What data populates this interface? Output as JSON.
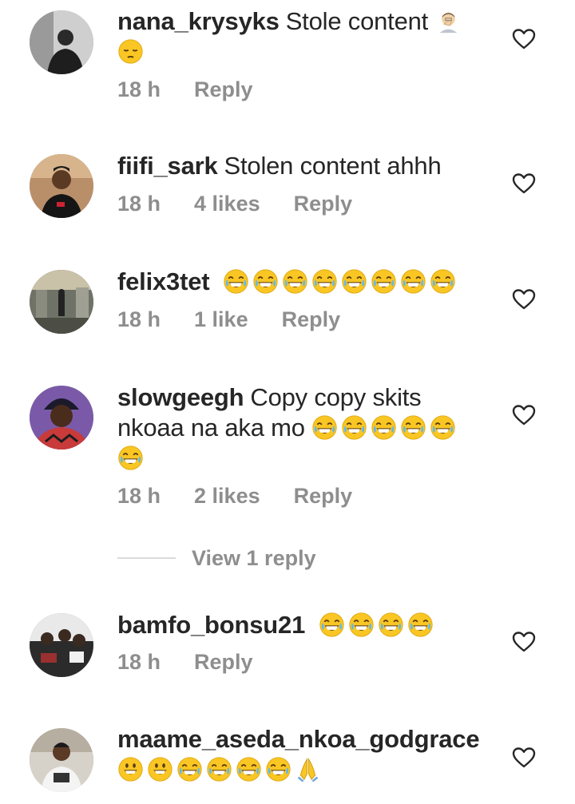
{
  "comments": [
    {
      "username": "nana_krysyks",
      "text": "Stole content",
      "time": "18 h",
      "likes": "",
      "reply": "Reply"
    },
    {
      "username": "fiifi_sark",
      "text": "Stolen content ahhh",
      "time": "18 h",
      "likes": "4 likes",
      "reply": "Reply"
    },
    {
      "username": "felix3tet",
      "text": "",
      "time": "18 h",
      "likes": "1 like",
      "reply": "Reply"
    },
    {
      "username": "slowgeegh",
      "text": "Copy copy skits nkoaa na aka mo",
      "time": "18 h",
      "likes": "2 likes",
      "reply": "Reply"
    },
    {
      "username": "bamfo_bonsu21",
      "text": "",
      "time": "18 h",
      "likes": "",
      "reply": "Reply"
    },
    {
      "username": "maame_aseda_nkoa_godgrace",
      "text": "",
      "time": "",
      "likes": "",
      "reply": ""
    }
  ],
  "view_replies_label": "View 1 reply",
  "icons": {
    "like": "heart-outline-icon",
    "emoji_laugh": "tears-of-joy-emoji",
    "emoji_smile": "grinning-face-emoji",
    "emoji_pensive": "pensive-face-emoji",
    "emoji_facepalm": "man-facepalming-emoji",
    "emoji_pray": "folded-hands-emoji"
  },
  "colors": {
    "text": "#262626",
    "secondary": "#8e8e8e",
    "emoji": "#f9c623"
  }
}
